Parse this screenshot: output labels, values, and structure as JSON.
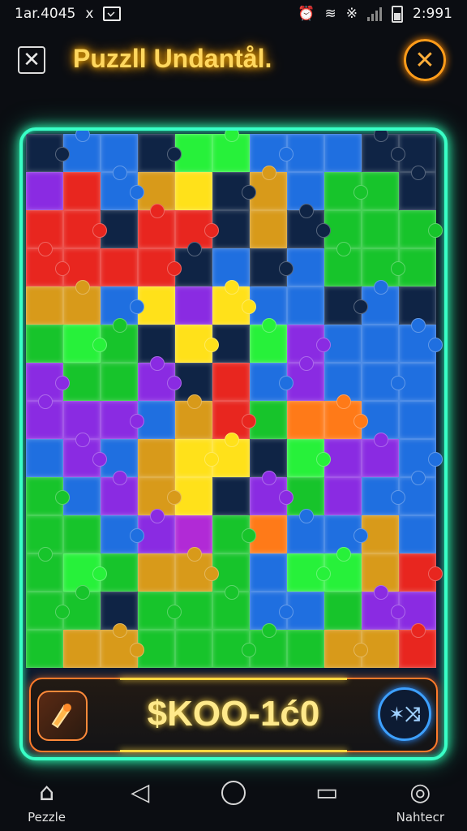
{
  "status_bar": {
    "left_text": "1ar.4045",
    "time": "2:991"
  },
  "header": {
    "title": "Puzzll Undantål."
  },
  "board": {
    "colors": {
      "R": "#e8261f",
      "O": "#ff7a18",
      "Y": "#ffe11a",
      "G": "#17c42b",
      "L": "#27f13a",
      "B": "#1f6fe0",
      "P": "#8a2be2",
      "M": "#b12ad6",
      "K": "#0f2445",
      "A": "#d89a1a",
      "D": "#20a04a"
    },
    "rows": [
      "KBBKLLBBBKK",
      "PRBAYKABGGK",
      "RRKRRKAKGGG",
      "RRRRKBKBGGG",
      "AABYPYBBKBK",
      "GLGKYKLPBBB",
      "PGGPKRBPBBB",
      "PPPBARGOOBB",
      "BPBAYYKLPPB",
      "GBPAYKPGPBB",
      "GGBPMGOBBAB",
      "GLGAAGBLLAR",
      "GGKGGGBBGPP",
      "GAAGGGGGAAR"
    ]
  },
  "score": {
    "text": "$KOO-1ć0"
  },
  "nav": {
    "items": [
      {
        "label": "Pezzle",
        "icon": "home-icon"
      },
      {
        "label": "",
        "icon": "back-icon"
      },
      {
        "label": "",
        "icon": "home-circle-icon"
      },
      {
        "label": "",
        "icon": "recent-icon"
      },
      {
        "label": "Nahtecr",
        "icon": "settings-icon"
      }
    ]
  }
}
